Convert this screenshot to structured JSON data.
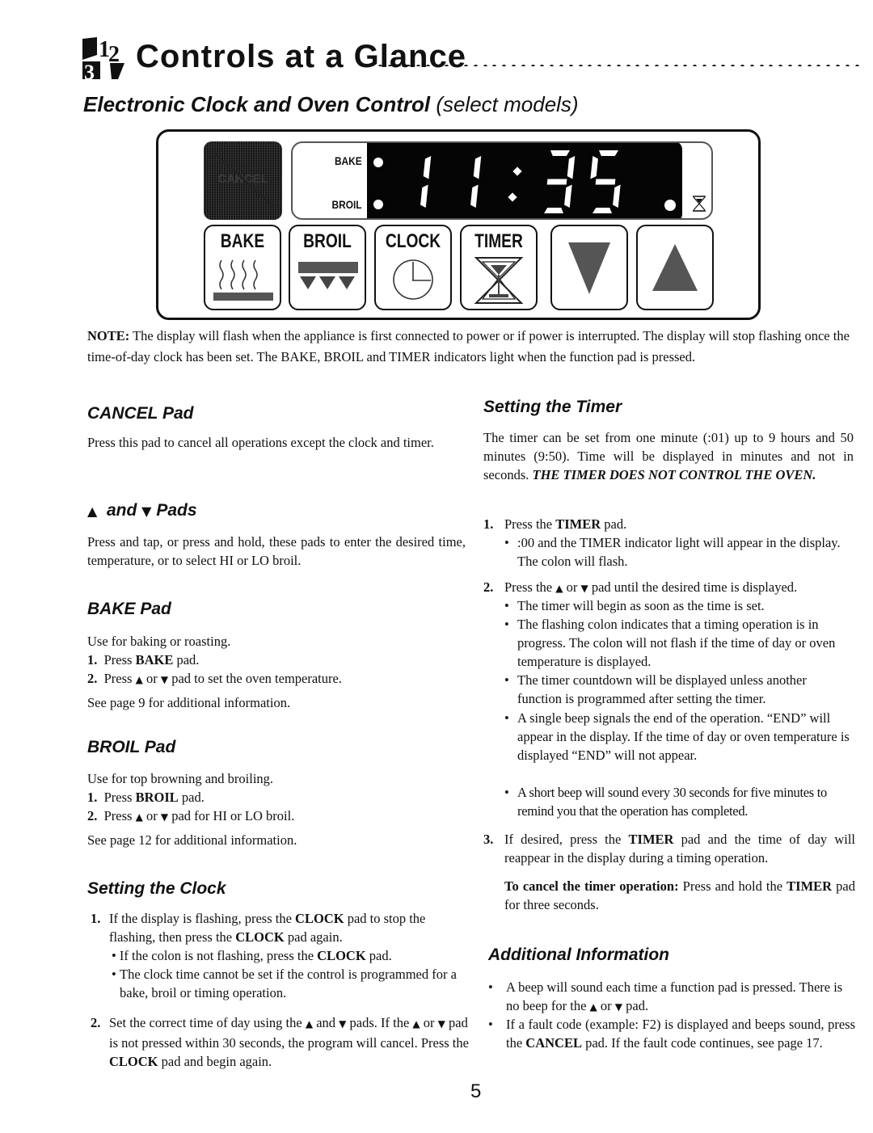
{
  "header": {
    "title": "Controls at a Glance",
    "subtitle_bold": "Electronic Clock and Oven Control",
    "subtitle_light": "(select models)"
  },
  "panel": {
    "cancel_pad_label": "CANCEL",
    "display": {
      "indicator_bake": "BAKE",
      "indicator_broil": "BROIL",
      "time": "11:35"
    },
    "pads": [
      {
        "label": "BAKE",
        "icon": "bake-heat-icon"
      },
      {
        "label": "BROIL",
        "icon": "broil-element-icon"
      },
      {
        "label": "CLOCK",
        "icon": "clock-icon"
      },
      {
        "label": "TIMER",
        "icon": "hourglass-icon"
      },
      {
        "label": "",
        "icon": "down-arrow-icon"
      },
      {
        "label": "",
        "icon": "up-arrow-icon"
      }
    ]
  },
  "note": {
    "lead": "NOTE:",
    "text": " The display will flash when the appliance is first connected to power or if power is interrupted. The display will stop flashing once the time-of-day clock has been set. The BAKE, BROIL and TIMER indicators light when the function pad is pressed."
  },
  "left": {
    "cancel": {
      "heading": "CANCEL Pad",
      "body": "Press this pad to cancel all operations except the clock and timer."
    },
    "arrows": {
      "heading_up": "▲",
      "heading_and": "and",
      "heading_down": "▼",
      "heading_pads": "Pads",
      "body": "Press and tap, or press and hold, these pads to enter the desired time, temperature, or to select HI or LO broil."
    },
    "bake": {
      "heading": "BAKE Pad",
      "intro": "Use for baking or roasting.",
      "step1_num": "1.",
      "step1_a": "Press ",
      "step1_b": "BAKE",
      "step1_c": " pad.",
      "step2_num": "2.",
      "step2_a": "Press ",
      "step2_up": "▲",
      "step2_or": " or ",
      "step2_down": "▼",
      "step2_c": " pad to set the oven temperature.",
      "see": "See page 9 for additional information."
    },
    "broil": {
      "heading": "BROIL Pad",
      "intro": "Use for top browning and broiling.",
      "step1_num": "1.",
      "step1_a": "Press ",
      "step1_b": "BROIL",
      "step1_c": " pad.",
      "step2_num": "2.",
      "step2_a": "Press ",
      "step2_up": "▲",
      "step2_or": " or ",
      "step2_down": "▼",
      "step2_c": " pad for HI  or LO broil.",
      "see": "See page 12 for additional information."
    },
    "clock": {
      "heading": "Setting the Clock",
      "step1_num": "1.",
      "step1_a": "If the display is flashing, press the ",
      "step1_b": "CLOCK",
      "step1_c": " pad to stop the flashing, then press the ",
      "step1_d": "CLOCK",
      "step1_e": " pad again.",
      "bullet1_a": "If the colon is not flashing, press the ",
      "bullet1_b": "CLOCK",
      "bullet1_c": " pad.",
      "bullet2": "The clock time cannot be set if the control is programmed for a bake, broil or timing operation.",
      "step2_num": "2.",
      "step2_a": "Set the correct time of day using the ",
      "step2_up": "▲",
      "step2_and": " and ",
      "step2_down": "▼",
      "step2_b": " pads. If the ",
      "step2_up2": "▲",
      "step2_or": " or ",
      "step2_down2": "▼",
      "step2_c": " pad is not pressed within 30 seconds, the program will cancel. Press the ",
      "step2_d": "CLOCK",
      "step2_e": " pad and begin again."
    }
  },
  "right": {
    "timer": {
      "heading": "Setting the Timer",
      "intro_a": "The timer can be set from one minute (:01) up to 9 hours and 50 minutes (9:50). Time will be displayed in minutes and not in seconds. ",
      "intro_b": "THE TIMER DOES NOT CONTROL THE OVEN.",
      "step1_num": "1.",
      "step1_a": "Press the ",
      "step1_b": "TIMER",
      "step1_c": " pad.",
      "step1_bullet": ":00 and the TIMER indicator light will appear in the display. The colon will flash.",
      "step2_num": "2.",
      "step2_a": "Press the ",
      "step2_up": "▲",
      "step2_or": " or ",
      "step2_down": "▼",
      "step2_c": " pad until the desired time is displayed.",
      "step2_bullets": [
        "The timer will begin as soon as the time is set.",
        "The flashing colon indicates that a timing operation is in progress. The colon will not flash if the time of day or oven temperature is displayed.",
        "The timer countdown will be displayed unless another function is programmed after setting the timer.",
        "A single beep signals the end of the operation. “END” will appear in the display. If the time of day or oven temperature is displayed “END” will not appear.",
        "A short beep will sound every 30 seconds for five minutes to remind you that the operation has completed."
      ],
      "step3_num": "3.",
      "step3_a": "If desired, press the ",
      "step3_b": "TIMER",
      "step3_c": " pad and the time of day will reappear in the display during a timing operation.",
      "cancel_a": "To cancel the timer operation:",
      "cancel_b": " Press and hold the ",
      "cancel_c": "TIMER",
      "cancel_d": " pad for three seconds."
    },
    "additional": {
      "heading": "Additional Information",
      "bullet1_a": "A beep will sound each time a function pad is pressed. There is no beep for the ",
      "bullet1_up": "▲",
      "bullet1_or": " or ",
      "bullet1_down": "▼",
      "bullet1_c": " pad.",
      "bullet2_a": "If a fault code (example: F2) is displayed and beeps sound, press the ",
      "bullet2_b": "CANCEL",
      "bullet2_c": " pad. If the fault code continues, see page 17."
    }
  },
  "footer": {
    "page_number": "5"
  }
}
